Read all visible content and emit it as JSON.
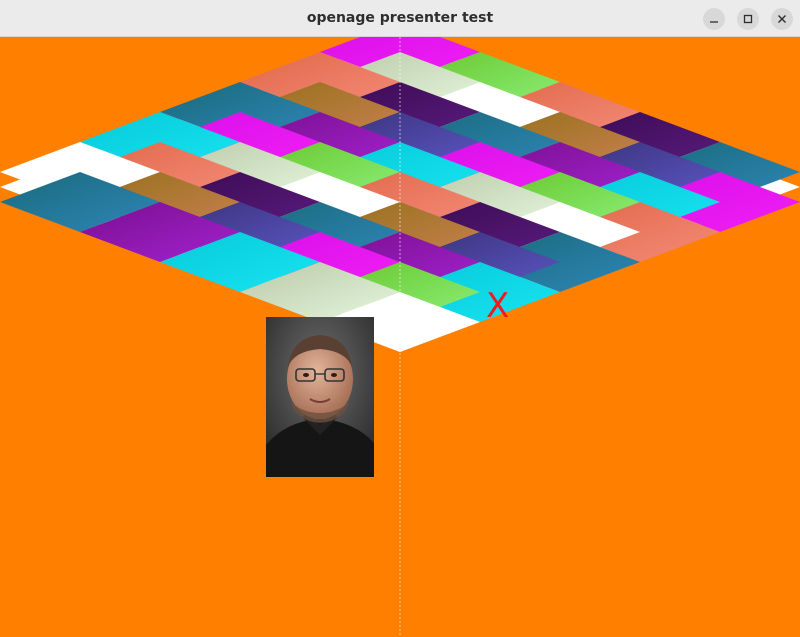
{
  "window": {
    "title": "openage presenter test",
    "controls": [
      "minimize-icon",
      "maximize-icon",
      "close-icon"
    ]
  },
  "scene": {
    "background_color": "#ff7f00",
    "board_color": "#ffffff",
    "photo": "portrait-image",
    "marker_text": "X",
    "marker_color": "#ee1c1c"
  }
}
